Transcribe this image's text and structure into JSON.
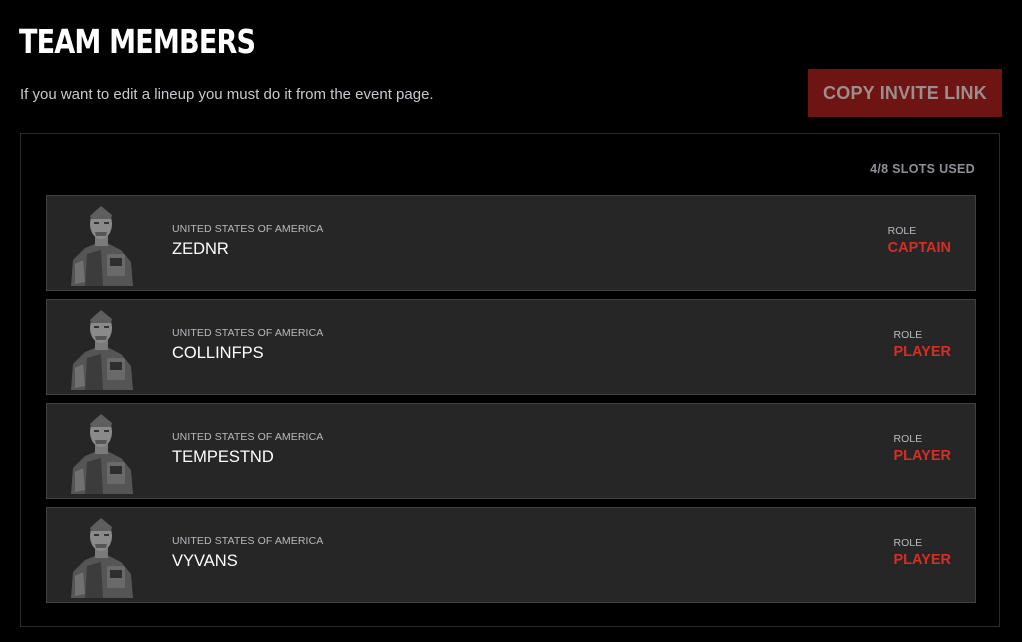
{
  "header": {
    "title": "TEAM MEMBERS",
    "subtitle": "If you want to edit a lineup you must do it from the event page.",
    "invite_button_label": "COPY INVITE LINK"
  },
  "panel": {
    "slots_label": "4/8 SLOTS USED"
  },
  "members": [
    {
      "country": "UNITED STATES OF AMERICA",
      "name": "ZEDNR",
      "role_label": "ROLE",
      "role": "CAPTAIN",
      "avatar_icon": "soldier-portrait-icon"
    },
    {
      "country": "UNITED STATES OF AMERICA",
      "name": "COLLINFPS",
      "role_label": "ROLE",
      "role": "PLAYER",
      "avatar_icon": "soldier-portrait-icon"
    },
    {
      "country": "UNITED STATES OF AMERICA",
      "name": "TEMPESTND",
      "role_label": "ROLE",
      "role": "PLAYER",
      "avatar_icon": "soldier-portrait-icon"
    },
    {
      "country": "UNITED STATES OF AMERICA",
      "name": "VYVANS",
      "role_label": "ROLE",
      "role": "PLAYER",
      "avatar_icon": "soldier-portrait-icon"
    }
  ],
  "colors": {
    "background": "#000000",
    "card_background": "#262626",
    "card_border": "#414141",
    "accent_red": "#d42f27",
    "invite_button_bg": "#6e1412"
  }
}
